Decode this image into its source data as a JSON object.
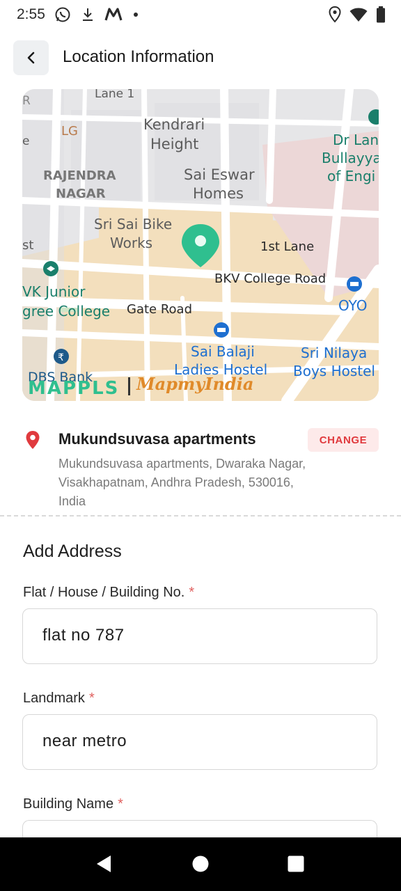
{
  "status_bar": {
    "time": "2:55",
    "left_icons": [
      "whatsapp-icon",
      "download-icon",
      "mappls-m-icon",
      "dot-icon"
    ],
    "right_icons": [
      "location-icon",
      "wifi-icon",
      "battery-icon"
    ]
  },
  "header": {
    "title": "Location Information",
    "back_icon": "chevron-left-icon"
  },
  "map": {
    "labels": {
      "lane1": "Lane 1",
      "lg": "LG",
      "kendrari": "Kendrari",
      "height": "Height",
      "rajendra": "RAJENDRA",
      "nagar": "NAGAR",
      "sai_eswar": "Sai Eswar",
      "homes": "Homes",
      "dr_lan": "Dr Lan",
      "bullayya": "Bullayya",
      "of_engi": "of Engi",
      "sri_sai_bike": "Sri Sai Bike",
      "works": "Works",
      "first_lane": "1st Lane",
      "bkv": "BKV College Road",
      "vk_junior": "VK Junior",
      "gree_college": "gree College",
      "gate_road": "Gate Road",
      "oyo": "OYO",
      "sai_balaji": "Sai Balaji",
      "ladies_hostel": "Ladies Hostel",
      "sri_nilaya": "Sri Nilaya",
      "boys_hostel": "Boys Hostel",
      "dbs_bank": "DBS Bank",
      "st": "st",
      "r": "R",
      "e": "e"
    },
    "brand_mappls": "MAPPLS",
    "brand_mapmyindia": "MapmyIndia",
    "pin_color": "#2fbf8f"
  },
  "location": {
    "name": "Mukundsuvasa apartments",
    "address": "Mukundsuvasa apartments, Dwaraka Nagar, Visakhapatnam, Andhra Pradesh, 530016, India",
    "change_label": "CHANGE"
  },
  "form": {
    "section_title": "Add Address",
    "fields": [
      {
        "label": "Flat / House / Building No.",
        "required_mark": "*",
        "value": "flat no 787"
      },
      {
        "label": "Landmark",
        "required_mark": "*",
        "value": "near metro"
      },
      {
        "label": "Building Name",
        "required_mark": "*",
        "value": ""
      }
    ]
  },
  "colors": {
    "accent_red": "#e03a3e",
    "change_bg": "#fdeaea"
  },
  "navigation_bar": {
    "icons": [
      "back-triangle-icon",
      "home-circle-icon",
      "recents-square-icon"
    ]
  }
}
